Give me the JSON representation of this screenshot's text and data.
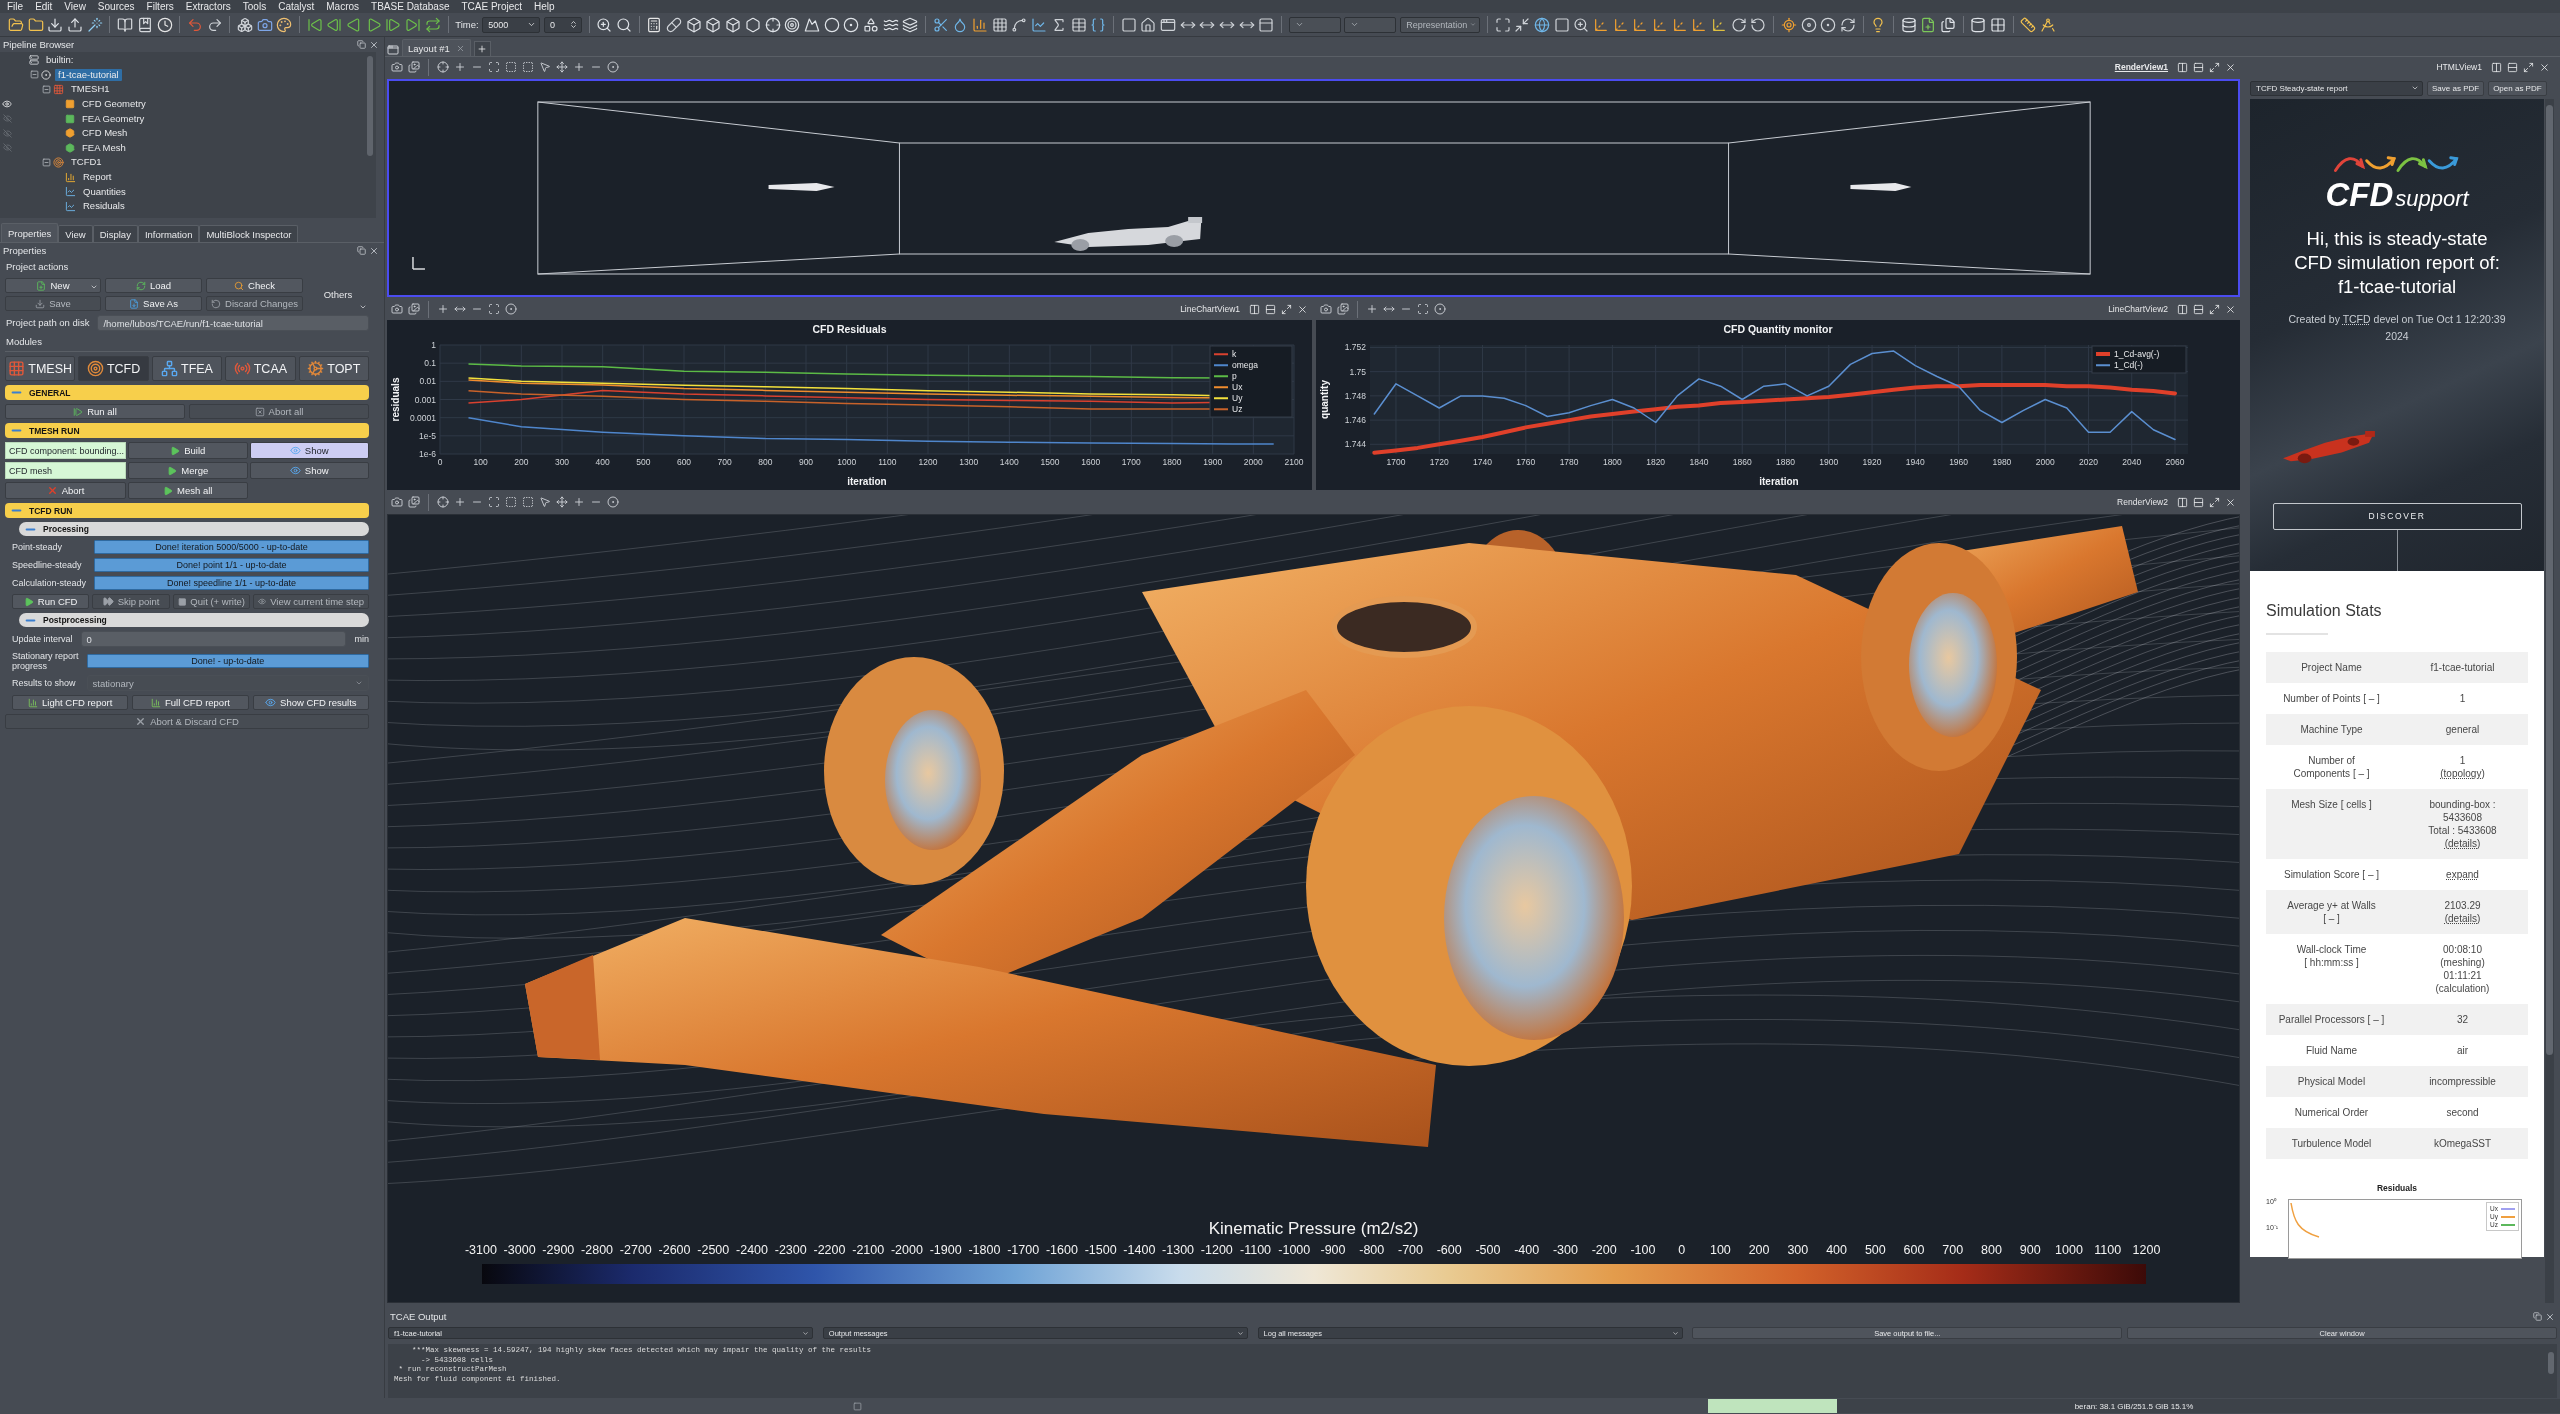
{
  "menu": [
    "File",
    "Edit",
    "View",
    "Sources",
    "Filters",
    "Extractors",
    "Tools",
    "Catalyst",
    "Macros",
    "TBASE Database",
    "TCAE Project",
    "Help"
  ],
  "toolbar": {
    "time_label": "Time:",
    "time_value": "5000",
    "timestep": "0",
    "representation": {
      "value": "Representation",
      "disabled": true
    }
  },
  "pipeline_browser": {
    "title": "Pipeline Browser",
    "tree": [
      {
        "label": "builtin:",
        "kind": "server",
        "selected": false,
        "children": [
          {
            "label": "f1-tcae-tutorial",
            "kind": "project",
            "selected": true,
            "expanded": true,
            "children": [
              {
                "label": "TMESH1",
                "kind": "mesher",
                "selected": false,
                "expanded": true,
                "children": [
                  {
                    "label": "CFD Geometry",
                    "kind": "geometry",
                    "color": "#f0a030",
                    "selected": false,
                    "visible": true
                  },
                  {
                    "label": "FEA Geometry",
                    "kind": "geometry",
                    "color": "#5cb85c",
                    "selected": false,
                    "visible": false
                  },
                  {
                    "label": "CFD Mesh",
                    "kind": "mesh",
                    "color": "#f0a030",
                    "selected": false,
                    "visible": false
                  },
                  {
                    "label": "FEA Mesh",
                    "kind": "mesh",
                    "color": "#5cb85c",
                    "selected": false,
                    "visible": false
                  }
                ]
              },
              {
                "label": "TCFD1",
                "kind": "solver",
                "selected": false,
                "expanded": true,
                "children": [
                  {
                    "label": "Report",
                    "kind": "report",
                    "selected": false
                  },
                  {
                    "label": "Quantities",
                    "kind": "plot",
                    "selected": false
                  },
                  {
                    "label": "Residuals",
                    "kind": "plot",
                    "selected": false
                  }
                ]
              }
            ]
          }
        ]
      }
    ]
  },
  "panel_tabs": [
    {
      "label": "Properties",
      "selected": true
    },
    {
      "label": "View",
      "selected": false
    },
    {
      "label": "Display",
      "selected": false
    },
    {
      "label": "Information",
      "selected": false
    },
    {
      "label": "MultiBlock Inspector",
      "selected": false
    }
  ],
  "properties": {
    "title": "Properties",
    "project_actions": {
      "title": "Project actions",
      "buttons": [
        {
          "label": "New",
          "kind": "new",
          "disabled": false,
          "menu": true
        },
        {
          "label": "Load",
          "kind": "load",
          "disabled": false,
          "menu": false
        },
        {
          "label": "Check",
          "kind": "check",
          "disabled": false,
          "menu": false
        },
        {
          "label": "Save",
          "kind": "save",
          "disabled": true,
          "menu": false
        },
        {
          "label": "Save As",
          "kind": "save_as",
          "disabled": false,
          "menu": false
        },
        {
          "label": "Discard Changes",
          "kind": "discard",
          "disabled": true,
          "menu": false
        }
      ],
      "others": "Others"
    },
    "project_path": {
      "label": "Project path on disk",
      "value": "/home/lubos/TCAE/run/f1-tcae-tutorial"
    },
    "modules": {
      "title": "Modules",
      "tabs": [
        {
          "label": "TMESH",
          "kind": "tmesh",
          "selected": false
        },
        {
          "label": "TCFD",
          "kind": "tcfd",
          "selected": true
        },
        {
          "label": "TFEA",
          "kind": "tfea",
          "selected": false
        },
        {
          "label": "TCAA",
          "kind": "tcaa",
          "selected": false
        },
        {
          "label": "TOPT",
          "kind": "topt",
          "selected": false
        }
      ]
    },
    "general": {
      "title": "GENERAL",
      "expanded": true,
      "buttons": [
        {
          "label": "Run all",
          "kind": "run_all",
          "disabled": false
        },
        {
          "label": "Abort all",
          "kind": "abort_all",
          "disabled": true
        }
      ]
    },
    "tmesh_run": {
      "title": "TMESH RUN",
      "expanded": true,
      "components": [
        {
          "label": "CFD component: bounding...",
          "action": "Build",
          "show": {
            "label": "Show",
            "selected": true
          }
        },
        {
          "label": "CFD mesh",
          "action": "Merge",
          "show": {
            "label": "Show",
            "selected": false
          }
        }
      ],
      "buttons": [
        {
          "label": "Abort",
          "kind": "abort",
          "disabled": false
        },
        {
          "label": "Mesh all",
          "kind": "play",
          "disabled": false
        }
      ]
    },
    "tcfd_run": {
      "title": "TCFD RUN",
      "expanded": true,
      "processing": {
        "title": "Processing",
        "expanded": true,
        "stages": [
          {
            "label": "Point-steady",
            "status": "Done! iteration 5000/5000 - up-to-date",
            "level": 1
          },
          {
            "label": "Speedline-steady",
            "status": "Done! point 1/1 - up-to-date",
            "level": 1
          },
          {
            "label": "Calculation-steady",
            "status": "Done! speedline 1/1 - up-to-date",
            "level": 1
          }
        ],
        "buttons": [
          {
            "label": "Run CFD",
            "kind": "play",
            "disabled": false
          },
          {
            "label": "Skip point",
            "kind": "skip",
            "disabled": true
          },
          {
            "label": "Quit (+ write)",
            "kind": "stop",
            "disabled": true
          },
          {
            "label": "View current time step",
            "kind": "eye",
            "disabled": true
          }
        ]
      },
      "postprocessing": {
        "title": "Postprocessing",
        "expanded": true,
        "update_interval": {
          "label": "Update interval",
          "value": "0",
          "unit": "min"
        },
        "report_progress": {
          "label": "Stationary report\nprogress",
          "status": "Done! - up-to-date",
          "level": 1
        },
        "results": {
          "label": "Results to show",
          "value": "stationary",
          "disabled": true
        },
        "buttons": [
          {
            "label": "Light CFD report",
            "kind": "report",
            "disabled": false
          },
          {
            "label": "Full CFD report",
            "kind": "report",
            "disabled": false
          },
          {
            "label": "Show CFD results",
            "kind": "eye",
            "disabled": false
          }
        ]
      },
      "abort_discard": {
        "label": "Abort & Discard CFD",
        "kind": "abort",
        "disabled": true
      }
    }
  },
  "layout_tabs": [
    {
      "label": "Layout #1",
      "selected": true
    }
  ],
  "render_view_1": {
    "title": "RenderView1",
    "active": true
  },
  "chart_views": [
    {
      "title": "LineChartView1",
      "active": false,
      "residuals_plot": {
        "title": "CFD Residuals",
        "xlabel": "iteration",
        "ylabel": "residuals",
        "xtick_labels": [
          "0",
          "100",
          "200",
          "300",
          "400",
          "500",
          "600",
          "700",
          "800",
          "900",
          "1000",
          "1100",
          "1200",
          "1300",
          "1400",
          "1500",
          "1600",
          "1700",
          "1800",
          "1900",
          "2000",
          "2100"
        ],
        "ytick_labels": [
          "1",
          "0.1",
          "0.01",
          "0.001",
          "0.0001",
          "1e-5",
          "1e-6"
        ],
        "series": [
          {
            "name": "k",
            "color": "#d9412f"
          },
          {
            "name": "omega",
            "color": "#4f86cc"
          },
          {
            "name": "p",
            "color": "#5cbb46"
          },
          {
            "name": "Ux",
            "color": "#f08c2e"
          },
          {
            "name": "Uy",
            "color": "#f3e13c"
          },
          {
            "name": "Uz",
            "color": "#c8622a"
          }
        ]
      }
    },
    {
      "title": "LineChartView2",
      "active": false,
      "chart_data": {
        "type": "line",
        "title": "CFD Quantity monitor",
        "xlabel": "iteration",
        "ylabel": "quantity",
        "grid": true,
        "legend": true,
        "x": [
          1690,
          1700,
          1710,
          1720,
          1730,
          1740,
          1750,
          1760,
          1770,
          1780,
          1790,
          1800,
          1810,
          1820,
          1830,
          1840,
          1850,
          1860,
          1870,
          1880,
          1890,
          1900,
          1910,
          1920,
          1930,
          1940,
          1950,
          1960,
          1970,
          1980,
          1990,
          2000,
          2010,
          2020,
          2030,
          2040,
          2050,
          2060
        ],
        "series": [
          {
            "name": "1_Cd-avg(-)",
            "color": "#e0402a",
            "values": [
              1.7433,
              1.7435,
              1.7437,
              1.744,
              1.7443,
              1.7446,
              1.745,
              1.7454,
              1.7457,
              1.746,
              1.7463,
              1.7465,
              1.7467,
              1.7469,
              1.7471,
              1.7472,
              1.7474,
              1.7475,
              1.7476,
              1.7477,
              1.7478,
              1.7479,
              1.7481,
              1.7483,
              1.7485,
              1.7487,
              1.7488,
              1.7488,
              1.7489,
              1.7489,
              1.7489,
              1.7489,
              1.7488,
              1.7488,
              1.7487,
              1.7485,
              1.7484,
              1.7482
            ]
          },
          {
            "name": "1_Cd(-)",
            "color": "#5b8fd0",
            "values": [
              1.7465,
              1.749,
              1.748,
              1.747,
              1.748,
              1.748,
              1.7478,
              1.7472,
              1.7463,
              1.7466,
              1.7472,
              1.7477,
              1.747,
              1.7458,
              1.748,
              1.7494,
              1.7488,
              1.7477,
              1.7488,
              1.749,
              1.748,
              1.7488,
              1.7506,
              1.7515,
              1.7517,
              1.7505,
              1.7496,
              1.7488,
              1.7468,
              1.7458,
              1.7468,
              1.7477,
              1.747,
              1.745,
              1.745,
              1.7467,
              1.7452,
              1.7444
            ]
          }
        ],
        "xlim": [
          1688,
          2066
        ],
        "ylim": [
          1.7432,
          1.7522
        ],
        "xticks": [
          {
            "value": 1700,
            "label": "1700"
          },
          {
            "value": 1720,
            "label": "1720"
          },
          {
            "value": 1740,
            "label": "1740"
          },
          {
            "value": 1760,
            "label": "1760"
          },
          {
            "value": 1780,
            "label": "1780"
          },
          {
            "value": 1800,
            "label": "1800"
          },
          {
            "value": 1820,
            "label": "1820"
          },
          {
            "value": 1840,
            "label": "1840"
          },
          {
            "value": 1860,
            "label": "1860"
          },
          {
            "value": 1880,
            "label": "1880"
          },
          {
            "value": 1900,
            "label": "1900"
          },
          {
            "value": 1920,
            "label": "1920"
          },
          {
            "value": 1940,
            "label": "1940"
          },
          {
            "value": 1960,
            "label": "1960"
          },
          {
            "value": 1980,
            "label": "1980"
          },
          {
            "value": 2000,
            "label": "2000"
          },
          {
            "value": 2020,
            "label": "2020"
          },
          {
            "value": 2040,
            "label": "2040"
          },
          {
            "value": 2060,
            "label": "2060"
          }
        ],
        "yticks": [
          {
            "value": 1.744,
            "label": "1.744"
          },
          {
            "value": 1.746,
            "label": "1.746"
          },
          {
            "value": 1.748,
            "label": "1.748"
          },
          {
            "value": 1.75,
            "label": "1.75"
          },
          {
            "value": 1.752,
            "label": "1.752"
          }
        ]
      }
    }
  ],
  "render_view_2": {
    "title": "RenderView2",
    "active": false,
    "color_legend": {
      "title": "Kinematic Pressure (m2/s2)",
      "labels": [
        "-3100",
        "-3000",
        "-2900",
        "-2800",
        "-2700",
        "-2600",
        "-2500",
        "-2400",
        "-2300",
        "-2200",
        "-2100",
        "-2000",
        "-1900",
        "-1800",
        "-1700",
        "-1600",
        "-1500",
        "-1400",
        "-1300",
        "-1200",
        "-1100",
        "-1000",
        "-900",
        "-800",
        "-700",
        "-600",
        "-500",
        "-400",
        "-300",
        "-200",
        "-100",
        "0",
        "100",
        "200",
        "300",
        "400",
        "500",
        "600",
        "700",
        "800",
        "900",
        "1000",
        "1100",
        "1200"
      ]
    }
  },
  "html_view": {
    "title": "HTMLView1",
    "report_select": "TCFD Steady-state report",
    "buttons": [
      "Save as PDF",
      "Open as PDF"
    ]
  },
  "report": {
    "logo": {
      "main": "CFD",
      "sub": "support"
    },
    "heading": "Hi, this is steady-state\nCFD simulation report of:\nf1-tcae-tutorial",
    "created": {
      "before": "Created by",
      "link": "TCFD",
      "after": "devel on Tue Oct 1 12:20:39 2024"
    },
    "discover": "DISCOVER",
    "stats": {
      "title": "Simulation Stats",
      "rows": [
        {
          "label": "Project Name",
          "value": [
            {
              "text": "f1-tcae-tutorial",
              "link": false
            }
          ]
        },
        {
          "label": "Number of Points [ – ]",
          "value": [
            {
              "text": "1",
              "link": false
            }
          ]
        },
        {
          "label": "Machine Type",
          "value": [
            {
              "text": "general",
              "link": false
            }
          ]
        },
        {
          "label": "Number of\nComponents [ – ]",
          "value": [
            {
              "text": "1",
              "link": false
            },
            {
              "text": "(topology)",
              "link": true
            }
          ]
        },
        {
          "label": "Mesh Size [ cells ]",
          "value": [
            {
              "text": "bounding-box :",
              "link": false
            },
            {
              "text": "5433608",
              "link": false
            },
            {
              "text": "Total : 5433608",
              "link": false
            },
            {
              "text": "(details)",
              "link": true
            }
          ]
        },
        {
          "label": "Simulation Score [ – ]",
          "value": [
            {
              "text": "expand",
              "link": true
            }
          ]
        },
        {
          "label": "Average y+ at Walls\n[ – ]",
          "value": [
            {
              "text": "2103.29",
              "link": false
            },
            {
              "text": "(details)",
              "link": true
            }
          ]
        },
        {
          "label": "Wall-clock Time\n[ hh:mm:ss ]",
          "value": [
            {
              "text": "00:08:10",
              "link": false
            },
            {
              "text": "(meshing)",
              "link": false
            },
            {
              "text": "01:11:21",
              "link": false
            },
            {
              "text": "(calculation)",
              "link": false
            }
          ]
        },
        {
          "label": "Parallel Processors [ – ]",
          "value": [
            {
              "text": "32",
              "link": false
            }
          ]
        },
        {
          "label": "Fluid Name",
          "value": [
            {
              "text": "air",
              "link": false
            }
          ]
        },
        {
          "label": "Physical Model",
          "value": [
            {
              "text": "incompressible",
              "link": false
            }
          ]
        },
        {
          "label": "Numerical Order",
          "value": [
            {
              "text": "second",
              "link": false
            }
          ]
        },
        {
          "label": "Turbulence Model",
          "value": [
            {
              "text": "kOmegaSST",
              "link": false
            }
          ]
        }
      ]
    },
    "residuals_preview": {
      "title": "Residuals",
      "yticks": [
        "10⁰",
        "10⁻¹"
      ],
      "series": [
        {
          "name": "Ux",
          "color": "#a0a0f0"
        },
        {
          "name": "Uy",
          "color": "#f0a040"
        },
        {
          "name": "Uz",
          "color": "#5cb85c"
        }
      ]
    }
  },
  "output": {
    "title": "TCAE Output",
    "project": "f1-tcae-tutorial",
    "filter": "Output messages",
    "log_level": "Log all messages",
    "buttons": [
      "Save output to file...",
      "Clear window"
    ],
    "lines": [
      "    ***Max skewness = 14.59247, 194 highly skew faces detected which may impair the quality of the results",
      "      -> 5433608 cells",
      " * run reconstructParMesh",
      "Mesh for fluid component #1 finished."
    ]
  },
  "status": {
    "memory": {
      "text": "beran: 38.1 GiB/251.5 GiB 15.1%",
      "level": 0.151
    }
  }
}
